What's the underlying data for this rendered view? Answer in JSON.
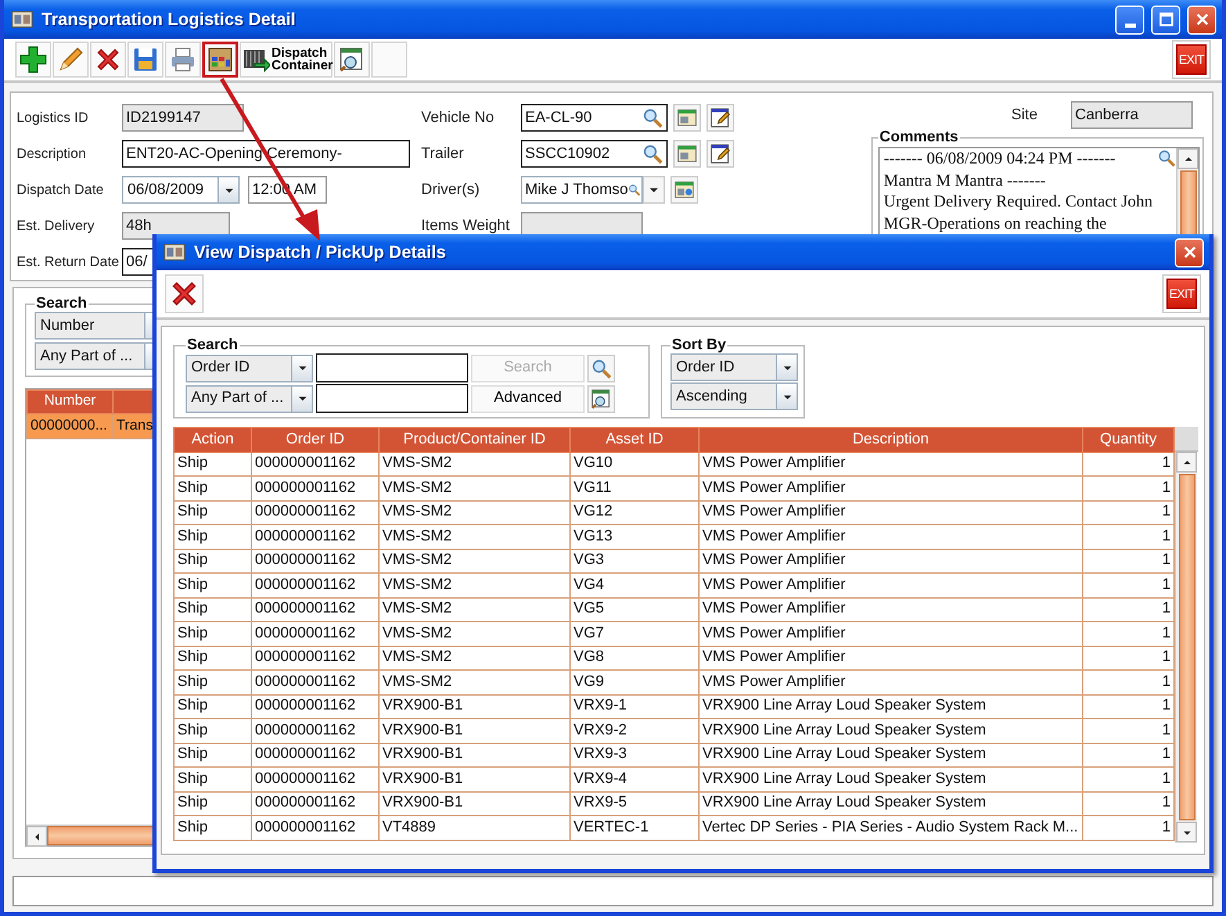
{
  "main_window": {
    "title": "Transportation Logistics Detail"
  },
  "toolbar": {
    "buttons": [
      {
        "kind": "add",
        "highlighted": false
      },
      {
        "kind": "edit",
        "highlighted": false
      },
      {
        "kind": "delete",
        "highlighted": false
      },
      {
        "kind": "save",
        "highlighted": false
      },
      {
        "kind": "print",
        "highlighted": false
      },
      {
        "kind": "view",
        "highlighted": true
      },
      {
        "kind": "container",
        "label": "Dispatch Container",
        "highlighted": false
      },
      {
        "kind": "report",
        "highlighted": false
      },
      {
        "kind": "blank",
        "highlighted": false
      }
    ],
    "exit_label": "EXIT"
  },
  "form": {
    "left": [
      {
        "label": "Logistics ID",
        "value": "ID2199147",
        "kind": "readonly"
      },
      {
        "label": "Description",
        "value": "ENT20-AC-Opening Ceremony-",
        "kind": "text"
      },
      {
        "label": "Dispatch Date",
        "value": "06/08/2009",
        "time": "12:00 AM",
        "kind": "date"
      },
      {
        "label": "Est. Delivery",
        "value": "48h",
        "kind": "readonly"
      },
      {
        "label": "Est. Return Date",
        "value": "06/",
        "kind": "text"
      }
    ],
    "middle": [
      {
        "label": "Vehicle No",
        "value": "EA-CL-90",
        "kind": "lookup"
      },
      {
        "label": "Trailer",
        "value": "SSCC10902",
        "kind": "lookup"
      },
      {
        "label": "Driver(s)",
        "value": "Mike J Thomso",
        "kind": "combo"
      },
      {
        "label": "Items Weight",
        "kind": "readonly"
      }
    ],
    "site": {
      "label": "Site",
      "value": "Canberra"
    },
    "comments": {
      "label": "Comments",
      "lines": [
        "------- 06/08/2009 04:24 PM -------",
        "Mantra M Mantra -------",
        "Urgent Delivery Required. Contact John",
        "MGR-Operations on reaching the"
      ]
    }
  },
  "list_panel": {
    "search": {
      "label": "Search",
      "field": "Number",
      "match": "Any Part of ..."
    },
    "table": {
      "columns": [
        "Number"
      ],
      "rows": [
        {
          "cells": [
            "00000000...",
            "Trans"
          ],
          "selected": true
        }
      ]
    }
  },
  "dialog": {
    "title": "View Dispatch / PickUp Details",
    "exit_label": "EXIT",
    "search": {
      "label": "Search",
      "field": "Order ID",
      "match": "Any Part of ...",
      "search_button": "Search",
      "search_disabled": true,
      "advanced_button": "Advanced"
    },
    "sort": {
      "label": "Sort By",
      "field": "Order ID",
      "order": "Ascending"
    },
    "table": {
      "columns": [
        "Action",
        "Order ID",
        "Product/Container ID",
        "Asset ID",
        "Description",
        "Quantity"
      ],
      "rows": [
        [
          "Ship",
          "000000001162",
          "VMS-SM2",
          "VG10",
          "VMS Power Amplifier",
          "1"
        ],
        [
          "Ship",
          "000000001162",
          "VMS-SM2",
          "VG11",
          "VMS Power Amplifier",
          "1"
        ],
        [
          "Ship",
          "000000001162",
          "VMS-SM2",
          "VG12",
          "VMS Power Amplifier",
          "1"
        ],
        [
          "Ship",
          "000000001162",
          "VMS-SM2",
          "VG13",
          "VMS Power Amplifier",
          "1"
        ],
        [
          "Ship",
          "000000001162",
          "VMS-SM2",
          "VG3",
          "VMS Power Amplifier",
          "1"
        ],
        [
          "Ship",
          "000000001162",
          "VMS-SM2",
          "VG4",
          "VMS Power Amplifier",
          "1"
        ],
        [
          "Ship",
          "000000001162",
          "VMS-SM2",
          "VG5",
          "VMS Power Amplifier",
          "1"
        ],
        [
          "Ship",
          "000000001162",
          "VMS-SM2",
          "VG7",
          "VMS Power Amplifier",
          "1"
        ],
        [
          "Ship",
          "000000001162",
          "VMS-SM2",
          "VG8",
          "VMS Power Amplifier",
          "1"
        ],
        [
          "Ship",
          "000000001162",
          "VMS-SM2",
          "VG9",
          "VMS Power Amplifier",
          "1"
        ],
        [
          "Ship",
          "000000001162",
          "VRX900-B1",
          "VRX9-1",
          "VRX900  Line Array Loud Speaker System",
          "1"
        ],
        [
          "Ship",
          "000000001162",
          "VRX900-B1",
          "VRX9-2",
          "VRX900  Line Array Loud Speaker System",
          "1"
        ],
        [
          "Ship",
          "000000001162",
          "VRX900-B1",
          "VRX9-3",
          "VRX900  Line Array Loud Speaker System",
          "1"
        ],
        [
          "Ship",
          "000000001162",
          "VRX900-B1",
          "VRX9-4",
          "VRX900  Line Array Loud Speaker System",
          "1"
        ],
        [
          "Ship",
          "000000001162",
          "VRX900-B1",
          "VRX9-5",
          "VRX900  Line Array Loud Speaker System",
          "1"
        ],
        [
          "Ship",
          "000000001162",
          "VT4889",
          "VERTEC-1",
          "Vertec DP Series - PIA Series - Audio System Rack M...",
          "1"
        ]
      ]
    }
  }
}
